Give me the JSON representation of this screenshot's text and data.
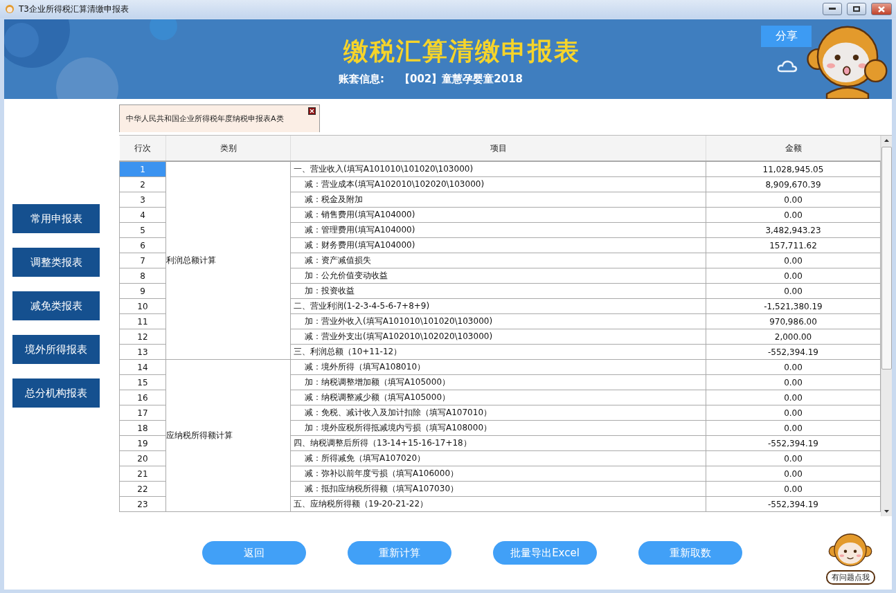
{
  "window": {
    "title": "T3企业所得税汇算清缴申报表"
  },
  "banner": {
    "title": "缴税汇算清缴申报表",
    "account_label": "账套信息:",
    "account_value": "【002】童慧孕婴童2018",
    "share_button": "分享"
  },
  "sidebar": {
    "items": [
      "常用申报表",
      "调整类报表",
      "减免类报表",
      "境外所得报表",
      "总分机构报表"
    ]
  },
  "tabs": [
    {
      "label": "中华人民共和国企业所得税年度纳税申报表A类",
      "selected": true
    }
  ],
  "table": {
    "columns": [
      "行次",
      "类别",
      "项目",
      "金额"
    ],
    "groups": [
      {
        "category": "利润总额计算",
        "rows": [
          {
            "no": "1",
            "item": "一、营业收入(填写A101010\\101020\\103000)",
            "kind": "main",
            "amount": "11,028,945.05",
            "selected": true
          },
          {
            "no": "2",
            "item": "减：营业成本(填写A102010\\102020\\103000)",
            "kind": "sub",
            "amount": "8,909,670.39",
            "selected": false
          },
          {
            "no": "3",
            "item": "减：税金及附加",
            "kind": "sub",
            "amount": "0.00",
            "selected": false
          },
          {
            "no": "4",
            "item": "减：销售费用(填写A104000)",
            "kind": "sub",
            "amount": "0.00",
            "selected": false
          },
          {
            "no": "5",
            "item": "减：管理费用(填写A104000)",
            "kind": "sub",
            "amount": "3,482,943.23",
            "selected": false
          },
          {
            "no": "6",
            "item": "减：财务费用(填写A104000)",
            "kind": "sub",
            "amount": "157,711.62",
            "selected": false
          },
          {
            "no": "7",
            "item": "减：资产减值损失",
            "kind": "sub",
            "amount": "0.00",
            "selected": false
          },
          {
            "no": "8",
            "item": "加：公允价值变动收益",
            "kind": "sub",
            "amount": "0.00",
            "selected": false
          },
          {
            "no": "9",
            "item": "加：投资收益",
            "kind": "sub",
            "amount": "0.00",
            "selected": false
          },
          {
            "no": "10",
            "item": "二、营业利润(1-2-3-4-5-6-7+8+9)",
            "kind": "main",
            "amount": "-1,521,380.19",
            "selected": false
          },
          {
            "no": "11",
            "item": "加：营业外收入(填写A101010\\101020\\103000)",
            "kind": "sub",
            "amount": "970,986.00",
            "selected": false
          },
          {
            "no": "12",
            "item": "减：营业外支出(填写A102010\\102020\\103000)",
            "kind": "sub",
            "amount": "2,000.00",
            "selected": false
          },
          {
            "no": "13",
            "item": "三、利润总额（10+11-12）",
            "kind": "main",
            "amount": "-552,394.19",
            "selected": false
          }
        ]
      },
      {
        "category": "应纳税所得额计算",
        "rows": [
          {
            "no": "14",
            "item": "减：境外所得（填写A108010）",
            "kind": "sub",
            "amount": "0.00",
            "selected": false
          },
          {
            "no": "15",
            "item": "加：纳税调整增加额（填写A105000）",
            "kind": "sub",
            "amount": "0.00",
            "selected": false
          },
          {
            "no": "16",
            "item": "减：纳税调整减少额（填写A105000）",
            "kind": "sub",
            "amount": "0.00",
            "selected": false
          },
          {
            "no": "17",
            "item": "减：免税、减计收入及加计扣除（填写A107010）",
            "kind": "sub",
            "amount": "0.00",
            "selected": false
          },
          {
            "no": "18",
            "item": "加：境外应税所得抵减境内亏损（填写A108000）",
            "kind": "sub",
            "amount": "0.00",
            "selected": false
          },
          {
            "no": "19",
            "item": "四、纳税调整后所得（13-14+15-16-17+18）",
            "kind": "main",
            "amount": "-552,394.19",
            "selected": false
          },
          {
            "no": "20",
            "item": "减：所得减免（填写A107020）",
            "kind": "sub",
            "amount": "0.00",
            "selected": false
          },
          {
            "no": "21",
            "item": "减：弥补以前年度亏损（填写A106000）",
            "kind": "sub",
            "amount": "0.00",
            "selected": false
          },
          {
            "no": "22",
            "item": "减：抵扣应纳税所得额（填写A107030）",
            "kind": "sub",
            "amount": "0.00",
            "selected": false
          },
          {
            "no": "23",
            "item": "五、应纳税所得额（19-20-21-22）",
            "kind": "main",
            "amount": "-552,394.19",
            "selected": false
          }
        ]
      }
    ]
  },
  "actions": [
    "返回",
    "重新计算",
    "批量导出Excel",
    "重新取数"
  ],
  "help_button": "有问题点我"
}
